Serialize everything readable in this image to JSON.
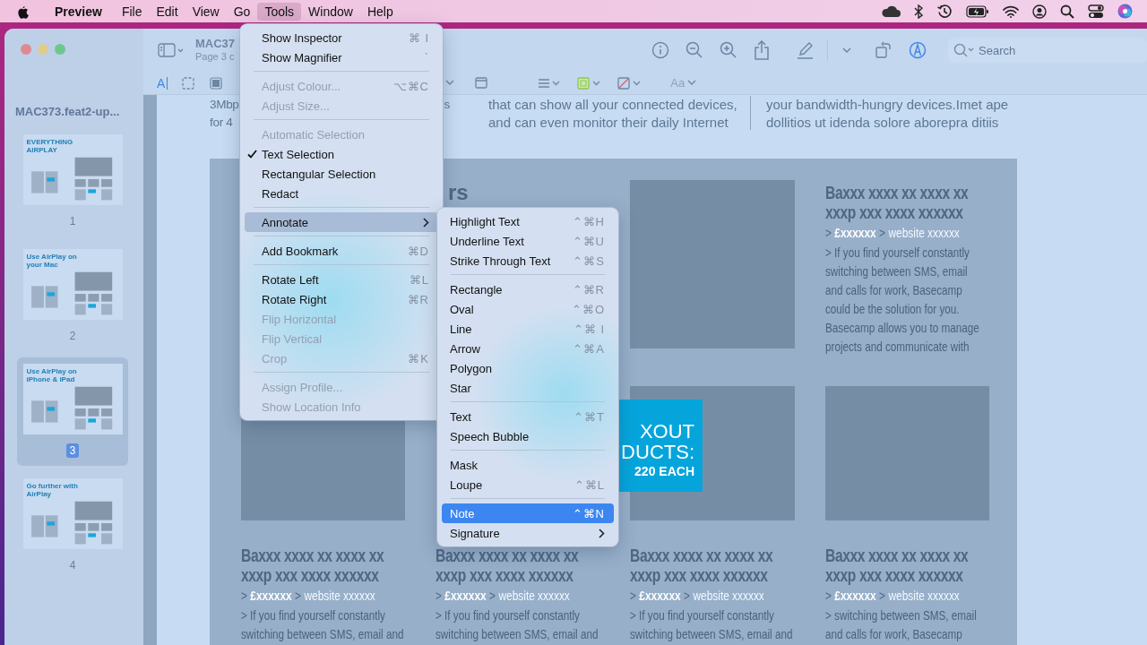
{
  "menu_bar": {
    "app": "Preview",
    "items": [
      {
        "label": "File",
        "selected": false
      },
      {
        "label": "Edit",
        "selected": false
      },
      {
        "label": "View",
        "selected": false
      },
      {
        "label": "Go",
        "selected": false
      },
      {
        "label": "Tools",
        "selected": true
      },
      {
        "label": "Window",
        "selected": false
      },
      {
        "label": "Help",
        "selected": false
      }
    ]
  },
  "sidebar": {
    "title": "MAC373.feat2-up...",
    "pages": [
      {
        "label": "1",
        "heading": "EVERYTHING AIRPLAY",
        "selected": false
      },
      {
        "label": "2",
        "heading": "Use AirPlay on your Mac",
        "selected": false
      },
      {
        "label": "3",
        "heading": "Use AirPlay on iPhone & iPad",
        "selected": true
      },
      {
        "label": "4",
        "heading": "Go further with AirPlay",
        "selected": false
      }
    ]
  },
  "toolbar": {
    "title": "MAC37",
    "subtitle": "Page 3 c",
    "search": {
      "placeholder": "Search"
    }
  },
  "markup_toolbar": {
    "text_tool": "A",
    "font_button": "Aa"
  },
  "document": {
    "top_columns": [
      {
        "lines": [
          [
            "3Mbp",
            "s"
          ],
          [
            "for 4"
          ]
        ]
      },
      {
        "lines": [
          [
            "that can show all your connected devices,"
          ],
          [
            "and can even monitor their daily Internet"
          ]
        ]
      },
      {
        "lines": [
          [
            "your bandwidth-hungry devices.Imet ape"
          ],
          [
            "dollitios ut idenda solore aborepra ditiis"
          ]
        ]
      }
    ],
    "heading_fragment": "rs",
    "promo": [
      "XOUT",
      "DUCTS:",
      "220 EACH"
    ],
    "feature_article": {
      "headline": [
        "Baxxx xxxx xx xxxx xx",
        "xxxp xxx xxxx xxxxxx"
      ],
      "meta": [
        {
          "kind": "marker",
          "text": ">"
        },
        {
          "kind": "author",
          "text": "£xxxxxx"
        },
        {
          "kind": "marker",
          "text": ">"
        },
        {
          "kind": "link",
          "text": "website xxxxxx"
        }
      ],
      "lines": [
        "> If you find yourself constantly",
        "switching between SMS, email",
        "and calls for work, Basecamp",
        "could be the solution for you.",
        "Basecamp allows you to manage",
        "projects and communicate with"
      ]
    },
    "articles": [
      {
        "headline": [
          "Baxxx xxxx xx xxxx xx",
          "xxxp xxx xxxx xxxxxx"
        ],
        "meta": [
          {
            "kind": "marker",
            "text": ">"
          },
          {
            "kind": "author",
            "text": "£xxxxxx"
          },
          {
            "kind": "marker",
            "text": ">"
          },
          {
            "kind": "link",
            "text": "website xxxxxx"
          }
        ],
        "lines": [
          "> If you find yourself constantly",
          "switching between SMS, email and"
        ]
      },
      {
        "headline": [
          "Baxxx xxxx xx xxxx xx",
          "xxxp xxx xxxx xxxxxx"
        ],
        "meta": [
          {
            "kind": "marker",
            "text": ">"
          },
          {
            "kind": "author",
            "text": "£xxxxxx"
          },
          {
            "kind": "marker",
            "text": ">"
          },
          {
            "kind": "link",
            "text": "website xxxxxx"
          }
        ],
        "lines": [
          "> If you find yourself constantly",
          "switching between SMS, email and"
        ]
      },
      {
        "headline": [
          "Baxxx xxxx xx xxxx xx",
          "xxxp xxx xxxx xxxxxx"
        ],
        "meta": [
          {
            "kind": "marker",
            "text": ">"
          },
          {
            "kind": "author",
            "text": "£xxxxxx"
          },
          {
            "kind": "marker",
            "text": ">"
          },
          {
            "kind": "link",
            "text": "website xxxxxx"
          }
        ],
        "lines": [
          "> If you find yourself constantly",
          "switching between SMS, email and"
        ]
      },
      {
        "headline": [
          "Baxxx xxxx xx xxxx xx",
          "xxxp xxx xxxx xxxxxx"
        ],
        "meta": [
          {
            "kind": "marker",
            "text": ">"
          },
          {
            "kind": "author",
            "text": "£xxxxxx"
          },
          {
            "kind": "marker",
            "text": ">"
          },
          {
            "kind": "link",
            "text": "website xxxxxx"
          }
        ],
        "lines": [
          "> switching between SMS, email",
          "and calls for work, Basecamp"
        ]
      }
    ]
  },
  "tools_menu": {
    "items": [
      {
        "kind": "item",
        "label": "Show Inspector",
        "shortcut": "⌘ I",
        "disabled": false,
        "checked": false,
        "selected": false
      },
      {
        "kind": "item",
        "label": "Show Magnifier",
        "shortcut": "`",
        "disabled": false,
        "checked": false,
        "selected": false
      },
      {
        "kind": "separator"
      },
      {
        "kind": "item",
        "label": "Adjust Colour...",
        "shortcut": "⌥⌘C",
        "disabled": true,
        "checked": false,
        "selected": false
      },
      {
        "kind": "item",
        "label": "Adjust Size...",
        "disabled": true,
        "checked": false,
        "selected": false
      },
      {
        "kind": "separator"
      },
      {
        "kind": "item",
        "label": "Automatic Selection",
        "disabled": true,
        "checked": false,
        "selected": false
      },
      {
        "kind": "item",
        "label": "Text Selection",
        "disabled": false,
        "checked": true,
        "selected": false
      },
      {
        "kind": "item",
        "label": "Rectangular Selection",
        "disabled": false,
        "checked": false,
        "selected": false
      },
      {
        "kind": "item",
        "label": "Redact",
        "disabled": false,
        "checked": false,
        "selected": false
      },
      {
        "kind": "separator"
      },
      {
        "kind": "submenu",
        "label": "Annotate",
        "disabled": false,
        "checked": false,
        "selected": true
      },
      {
        "kind": "separator"
      },
      {
        "kind": "item",
        "label": "Add Bookmark",
        "shortcut": "⌘D",
        "disabled": false,
        "checked": false,
        "selected": false
      },
      {
        "kind": "separator"
      },
      {
        "kind": "item",
        "label": "Rotate Left",
        "shortcut": "⌘L",
        "disabled": false,
        "checked": false,
        "selected": false
      },
      {
        "kind": "item",
        "label": "Rotate Right",
        "shortcut": "⌘R",
        "disabled": false,
        "checked": false,
        "selected": false
      },
      {
        "kind": "item",
        "label": "Flip Horizontal",
        "disabled": true,
        "checked": false,
        "selected": false
      },
      {
        "kind": "item",
        "label": "Flip Vertical",
        "disabled": true,
        "checked": false,
        "selected": false
      },
      {
        "kind": "item",
        "label": "Crop",
        "shortcut": "⌘K",
        "disabled": true,
        "checked": false,
        "selected": false
      },
      {
        "kind": "separator"
      },
      {
        "kind": "item",
        "label": "Assign Profile...",
        "disabled": true,
        "checked": false,
        "selected": false
      },
      {
        "kind": "item",
        "label": "Show Location Info",
        "disabled": true,
        "checked": false,
        "selected": false
      }
    ]
  },
  "annotate_menu": {
    "items": [
      {
        "kind": "item",
        "label": "Highlight Text",
        "shortcut": "⌃⌘H",
        "selected": false
      },
      {
        "kind": "item",
        "label": "Underline Text",
        "shortcut": "⌃⌘U",
        "selected": false
      },
      {
        "kind": "item",
        "label": "Strike Through Text",
        "shortcut": "⌃⌘S",
        "selected": false
      },
      {
        "kind": "separator"
      },
      {
        "kind": "item",
        "label": "Rectangle",
        "shortcut": "⌃⌘R",
        "selected": false
      },
      {
        "kind": "item",
        "label": "Oval",
        "shortcut": "⌃⌘O",
        "selected": false
      },
      {
        "kind": "item",
        "label": "Line",
        "shortcut": "⌃⌘ I",
        "selected": false
      },
      {
        "kind": "item",
        "label": "Arrow",
        "shortcut": "⌃⌘A",
        "selected": false
      },
      {
        "kind": "item",
        "label": "Polygon",
        "selected": false
      },
      {
        "kind": "item",
        "label": "Star",
        "selected": false
      },
      {
        "kind": "separator"
      },
      {
        "kind": "item",
        "label": "Text",
        "shortcut": "⌃⌘T",
        "selected": false
      },
      {
        "kind": "item",
        "label": "Speech Bubble",
        "selected": false
      },
      {
        "kind": "separator"
      },
      {
        "kind": "item",
        "label": "Mask",
        "selected": false
      },
      {
        "kind": "item",
        "label": "Loupe",
        "shortcut": "⌃⌘L",
        "selected": false
      },
      {
        "kind": "separator"
      },
      {
        "kind": "item",
        "label": "Note",
        "shortcut": "⌃⌘N",
        "selected": true
      },
      {
        "kind": "submenu",
        "label": "Signature",
        "selected": false
      }
    ]
  }
}
